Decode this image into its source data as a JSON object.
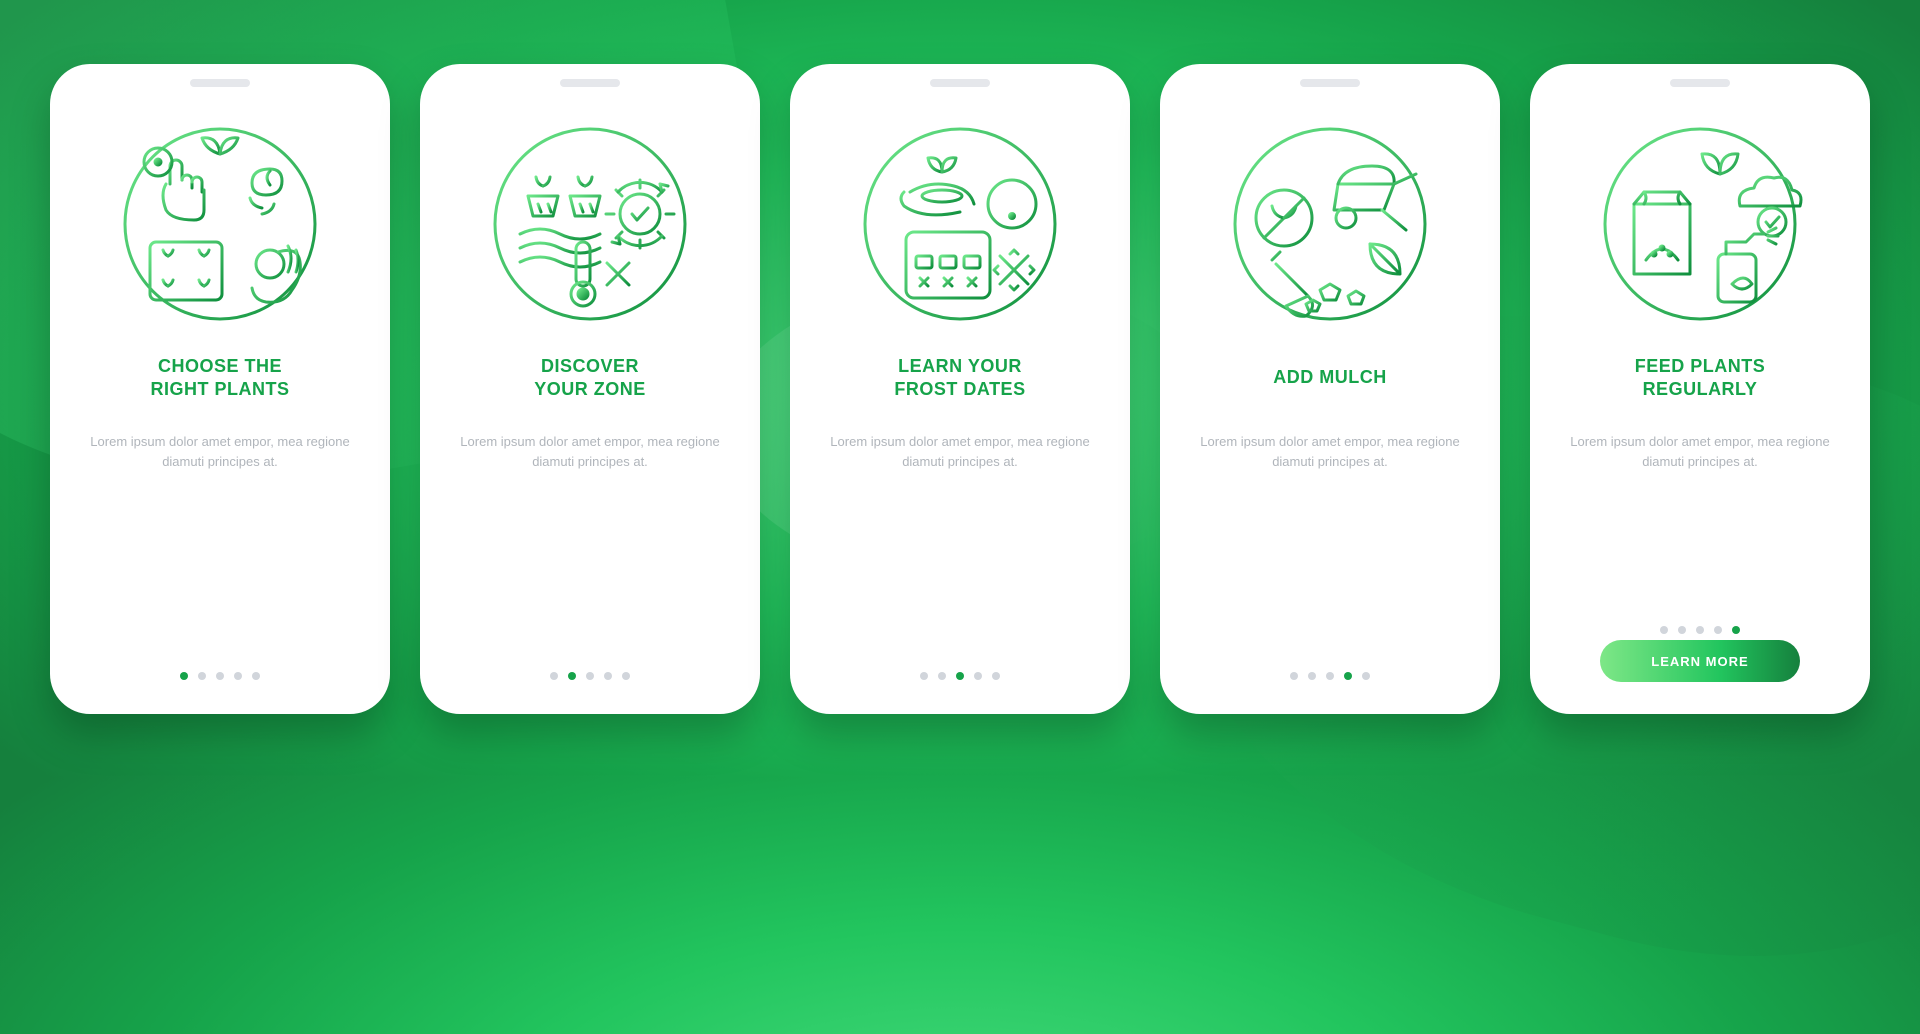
{
  "colors": {
    "accent": "#16a34a",
    "muted": "#d1d5db",
    "body": "#b0b5bb"
  },
  "body_text": "Lorem ipsum dolor amet empor, mea regione diamuti principes at.",
  "cta_label": "LEARN MORE",
  "total_pages": 5,
  "screens": [
    {
      "title": "CHOOSE THE\nRIGHT PLANTS",
      "icon_name": "choose-plants-icon",
      "active_dot": 0,
      "show_cta": false
    },
    {
      "title": "DISCOVER\nYOUR ZONE",
      "icon_name": "discover-zone-icon",
      "active_dot": 1,
      "show_cta": false
    },
    {
      "title": "LEARN YOUR\nFROST DATES",
      "icon_name": "frost-dates-icon",
      "active_dot": 2,
      "show_cta": false
    },
    {
      "title": "ADD MULCH",
      "icon_name": "add-mulch-icon",
      "active_dot": 3,
      "show_cta": false
    },
    {
      "title": "FEED PLANTS\nREGULARLY",
      "icon_name": "feed-plants-icon",
      "active_dot": 4,
      "show_cta": true
    }
  ]
}
